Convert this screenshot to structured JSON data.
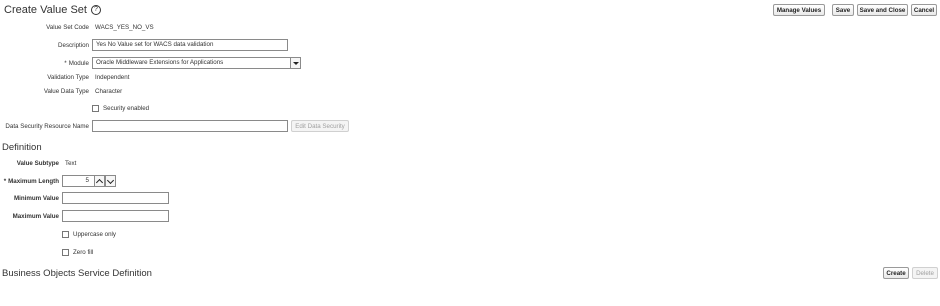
{
  "page": {
    "title": "Create Value Set",
    "help_icon": "?"
  },
  "toolbar": {
    "manage_values": "Manage Values",
    "save": "Save",
    "save_and_close": "Save and Close",
    "cancel": "Cancel"
  },
  "form": {
    "value_set_code": {
      "label": "Value Set Code",
      "value": "WACS_YES_NO_VS"
    },
    "description": {
      "label": "Description",
      "value": "Yes No Value set for WACS data validation"
    },
    "module": {
      "label": "Module",
      "required": "*",
      "value": "Oracle Middleware Extensions for Applications"
    },
    "validation_type": {
      "label": "Validation Type",
      "value": "Independent"
    },
    "value_data_type": {
      "label": "Value Data Type",
      "value": "Character"
    },
    "security_enabled": {
      "label": "Security enabled",
      "checked": false
    },
    "data_security_resource_name": {
      "label": "Data Security Resource Name",
      "value": ""
    },
    "edit_data_security": "Edit Data Security"
  },
  "definition": {
    "heading": "Definition",
    "value_subtype": {
      "label": "Value Subtype",
      "value": "Text"
    },
    "maximum_length": {
      "label": "Maximum Length",
      "required": "*",
      "value": "5"
    },
    "minimum_value": {
      "label": "Minimum Value",
      "value": ""
    },
    "maximum_value": {
      "label": "Maximum Value",
      "value": ""
    },
    "uppercase_only": {
      "label": "Uppercase only",
      "checked": false
    },
    "zero_fill": {
      "label": "Zero fill",
      "checked": false
    }
  },
  "bos": {
    "heading": "Business Objects Service Definition",
    "create": "Create",
    "delete": "Delete"
  }
}
